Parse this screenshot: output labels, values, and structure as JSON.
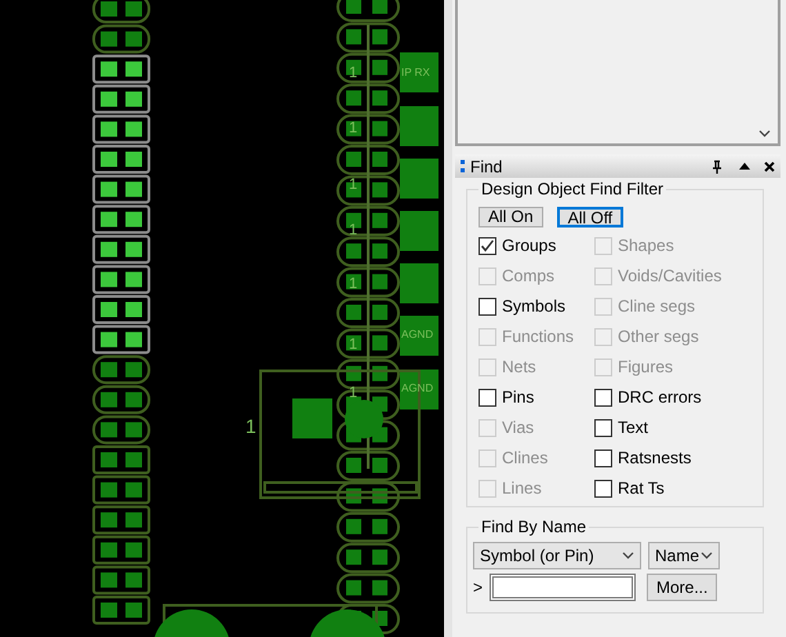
{
  "canvas": {
    "labels": [
      {
        "text": "IP RX"
      },
      {
        "text": "AGND"
      },
      {
        "text": "AGND"
      },
      {
        "text": "1"
      },
      {
        "text": "1"
      },
      {
        "text": "1"
      },
      {
        "text": "1"
      },
      {
        "text": "1"
      },
      {
        "text": "1"
      },
      {
        "text": "1"
      },
      {
        "text": "1"
      }
    ]
  },
  "find_panel": {
    "title": "Find",
    "filter": {
      "title": "Design Object Find Filter",
      "buttons": [
        {
          "label": "All On",
          "focused": false
        },
        {
          "label": "All Off",
          "focused": true
        }
      ],
      "options": [
        {
          "label": "Groups",
          "checked": true,
          "disabled": false
        },
        {
          "label": "Shapes",
          "checked": false,
          "disabled": true
        },
        {
          "label": "Comps",
          "checked": false,
          "disabled": true
        },
        {
          "label": "Voids/Cavities",
          "checked": false,
          "disabled": true
        },
        {
          "label": "Symbols",
          "checked": false,
          "disabled": false
        },
        {
          "label": "Cline segs",
          "checked": false,
          "disabled": true
        },
        {
          "label": "Functions",
          "checked": false,
          "disabled": true
        },
        {
          "label": "Other segs",
          "checked": false,
          "disabled": true
        },
        {
          "label": "Nets",
          "checked": false,
          "disabled": true
        },
        {
          "label": "Figures",
          "checked": false,
          "disabled": true
        },
        {
          "label": "Pins",
          "checked": false,
          "disabled": false
        },
        {
          "label": "DRC errors",
          "checked": false,
          "disabled": false
        },
        {
          "label": "Vias",
          "checked": false,
          "disabled": true
        },
        {
          "label": "Text",
          "checked": false,
          "disabled": false
        },
        {
          "label": "Clines",
          "checked": false,
          "disabled": true
        },
        {
          "label": "Ratsnests",
          "checked": false,
          "disabled": false
        },
        {
          "label": "Lines",
          "checked": false,
          "disabled": true
        },
        {
          "label": "Rat Ts",
          "checked": false,
          "disabled": false
        }
      ]
    },
    "find_by_name": {
      "title": "Find By Name",
      "type_select": "Symbol (or Pin)",
      "field_select": "Name",
      "prompt": ">",
      "more_button": "More..."
    }
  }
}
